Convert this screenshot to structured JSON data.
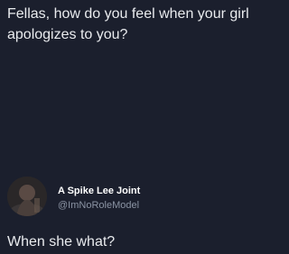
{
  "post": {
    "text": "Fellas, how do you feel when your girl apologizes to you?"
  },
  "reply": {
    "avatar_icon": "profile-photo",
    "display_name": "A Spike Lee Joint",
    "handle": "@ImNoRoleModel",
    "text": "When she what?"
  },
  "colors": {
    "background": "#1b1f2d",
    "text": "#e9ebee",
    "handle": "#8a93a3"
  }
}
